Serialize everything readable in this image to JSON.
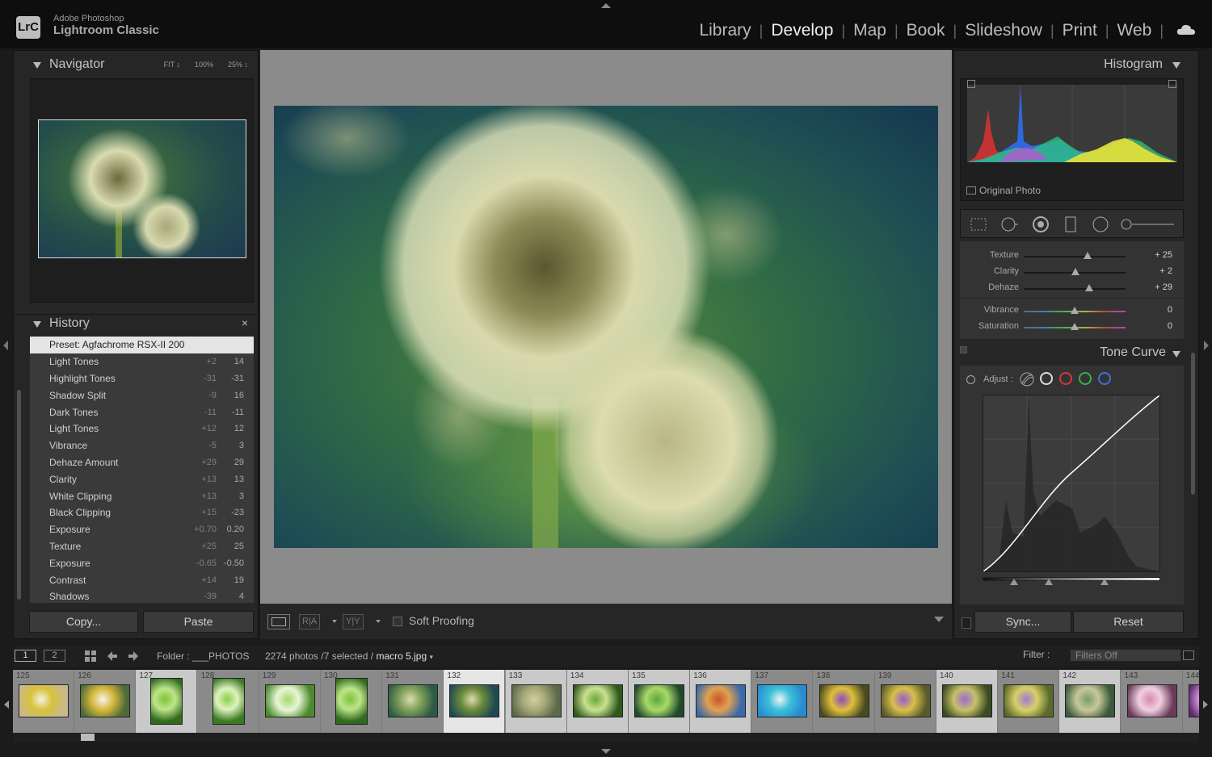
{
  "app": {
    "logo": "LrC",
    "vendor": "Adobe Photoshop",
    "name": "Lightroom Classic",
    "modules": [
      "Library",
      "Develop",
      "Map",
      "Book",
      "Slideshow",
      "Print",
      "Web"
    ],
    "active_module": "Develop"
  },
  "navigator": {
    "title": "Navigator",
    "zoom_options": [
      "FIT ↕",
      "100%",
      "25% ↕"
    ]
  },
  "history": {
    "title": "History",
    "close": "×",
    "items": [
      {
        "name": "Preset: Agfachrome RSX-II 200",
        "delta": "",
        "value": ""
      },
      {
        "name": "Light Tones",
        "delta": "+2",
        "value": "14"
      },
      {
        "name": "Highlight Tones",
        "delta": "-31",
        "value": "-31"
      },
      {
        "name": "Shadow Split",
        "delta": "-9",
        "value": "16"
      },
      {
        "name": "Dark Tones",
        "delta": "-11",
        "value": "-11"
      },
      {
        "name": "Light Tones",
        "delta": "+12",
        "value": "12"
      },
      {
        "name": "Vibrance",
        "delta": "-5",
        "value": "3"
      },
      {
        "name": "Dehaze Amount",
        "delta": "+29",
        "value": "29"
      },
      {
        "name": "Clarity",
        "delta": "+13",
        "value": "13"
      },
      {
        "name": "White Clipping",
        "delta": "+13",
        "value": "3"
      },
      {
        "name": "Black Clipping",
        "delta": "+15",
        "value": "-23"
      },
      {
        "name": "Exposure",
        "delta": "+0.70",
        "value": "0.20"
      },
      {
        "name": "Texture",
        "delta": "+25",
        "value": "25"
      },
      {
        "name": "Exposure",
        "delta": "-0.65",
        "value": "-0.50"
      },
      {
        "name": "Contrast",
        "delta": "+14",
        "value": "19"
      },
      {
        "name": "Shadows",
        "delta": "-39",
        "value": "4"
      }
    ],
    "copy_label": "Copy...",
    "paste_label": "Paste"
  },
  "toolbar": {
    "before_after_lr": "R|A",
    "before_after_yy": "Y|Y",
    "soft_proofing": "Soft Proofing"
  },
  "histogram": {
    "title": "Histogram",
    "original_photo": "Original Photo"
  },
  "basic": {
    "sliders": [
      {
        "label": "Texture",
        "value": "+ 25",
        "level": 0.625,
        "kind": "gray"
      },
      {
        "label": "Clarity",
        "value": "+ 2",
        "level": 0.51,
        "kind": "gray"
      },
      {
        "label": "Dehaze",
        "value": "+ 29",
        "level": 0.645,
        "kind": "gray"
      },
      {
        "label": "Vibrance",
        "value": "0",
        "level": 0.5,
        "kind": "color"
      },
      {
        "label": "Saturation",
        "value": "0",
        "level": 0.5,
        "kind": "color"
      }
    ]
  },
  "tone_curve": {
    "title": "Tone Curve",
    "adjust_label": "Adjust :"
  },
  "right_buttons": {
    "sync": "Sync...",
    "reset": "Reset"
  },
  "filmstrip": {
    "screen_1": "1",
    "screen_2": "2",
    "folder_label": "Folder :",
    "folder_name": "___PHOTOS",
    "count_text": "2274 photos /7 selected /",
    "current_file": "macro 5.jpg",
    "filter_label": "Filter :",
    "filter_value": "Filters Off",
    "cells": [
      {
        "num": "125",
        "state": "",
        "theme": "daisy"
      },
      {
        "num": "126",
        "state": "",
        "theme": "daisy2"
      },
      {
        "num": "127",
        "state": "sel",
        "theme": "grass"
      },
      {
        "num": "128",
        "state": "",
        "theme": "grass2"
      },
      {
        "num": "129",
        "state": "",
        "theme": "dew"
      },
      {
        "num": "130",
        "state": "",
        "theme": "grass"
      },
      {
        "num": "131",
        "state": "",
        "theme": "dandelion"
      },
      {
        "num": "132",
        "state": "active",
        "theme": "dandelion2"
      },
      {
        "num": "133",
        "state": "sel",
        "theme": "dandelion3"
      },
      {
        "num": "134",
        "state": "sel",
        "theme": "bug"
      },
      {
        "num": "135",
        "state": "sel",
        "theme": "fern"
      },
      {
        "num": "136",
        "state": "sel",
        "theme": "autumn"
      },
      {
        "num": "137",
        "state": "",
        "theme": "beach"
      },
      {
        "num": "138",
        "state": "",
        "theme": "crocus"
      },
      {
        "num": "139",
        "state": "",
        "theme": "crocus2"
      },
      {
        "num": "140",
        "state": "sel",
        "theme": "crocus3"
      },
      {
        "num": "141",
        "state": "",
        "theme": "crocus4"
      },
      {
        "num": "142",
        "state": "sel",
        "theme": "pond"
      },
      {
        "num": "143",
        "state": "",
        "theme": "flowers"
      },
      {
        "num": "144",
        "state": "",
        "theme": "purple"
      }
    ]
  },
  "colors": {
    "background": "#1b1b1b",
    "panel": "#262626",
    "canvas": "#8b8b8b",
    "active_text": "#f0f0f0"
  }
}
